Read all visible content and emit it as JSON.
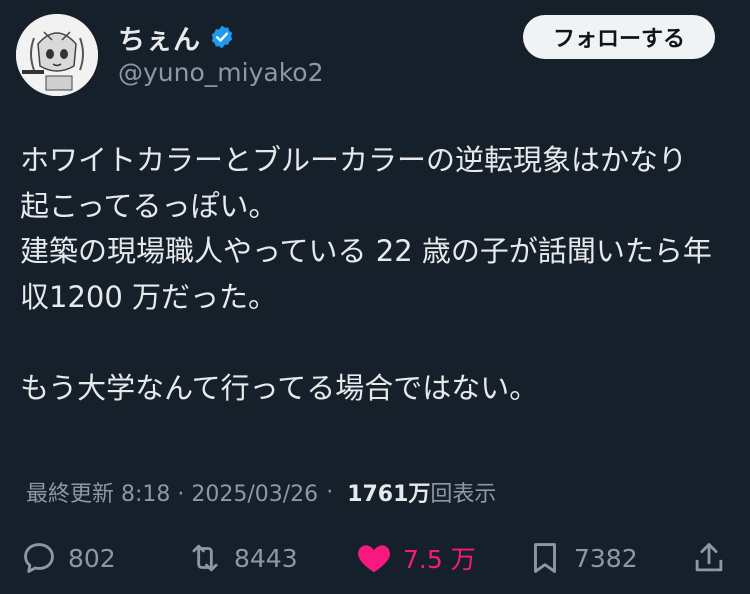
{
  "user": {
    "display_name": "ちぇん",
    "handle": "@yuno_miyako2",
    "verified": true,
    "verified_icon": "verified-badge-icon",
    "avatar_icon": "avatar-illustration"
  },
  "follow_button": {
    "label": "フォローする"
  },
  "tweet": {
    "lines": [
      "ホワイトカラーとブルーカラーの逆転現象はかなり",
      "起こってるっぽい。",
      "建築の現場職人やっている 22 歳の子が話聞いたら年",
      "収1200 万だった。",
      "",
      "もう大学なんて行ってる場合ではない。"
    ]
  },
  "meta": {
    "edited_time": "最終更新 8:18 · 2025/03/26",
    "separator": "·",
    "views_count": "1761万",
    "views_label": "回表示"
  },
  "actions": {
    "reply": {
      "icon": "reply-icon",
      "count": "802"
    },
    "retweet": {
      "icon": "retweet-icon",
      "count": "8443"
    },
    "like": {
      "icon": "heart-icon",
      "count": "7.5 万",
      "active": true
    },
    "bookmark": {
      "icon": "bookmark-icon",
      "count": "7382"
    },
    "share": {
      "icon": "share-icon"
    }
  },
  "colors": {
    "background": "#15202b",
    "text_primary": "#e7e9ea",
    "text_secondary": "#8b98a5",
    "verified_blue": "#1d9bf0",
    "like_pink": "#f91880",
    "follow_button_bg": "#eff3f4"
  }
}
